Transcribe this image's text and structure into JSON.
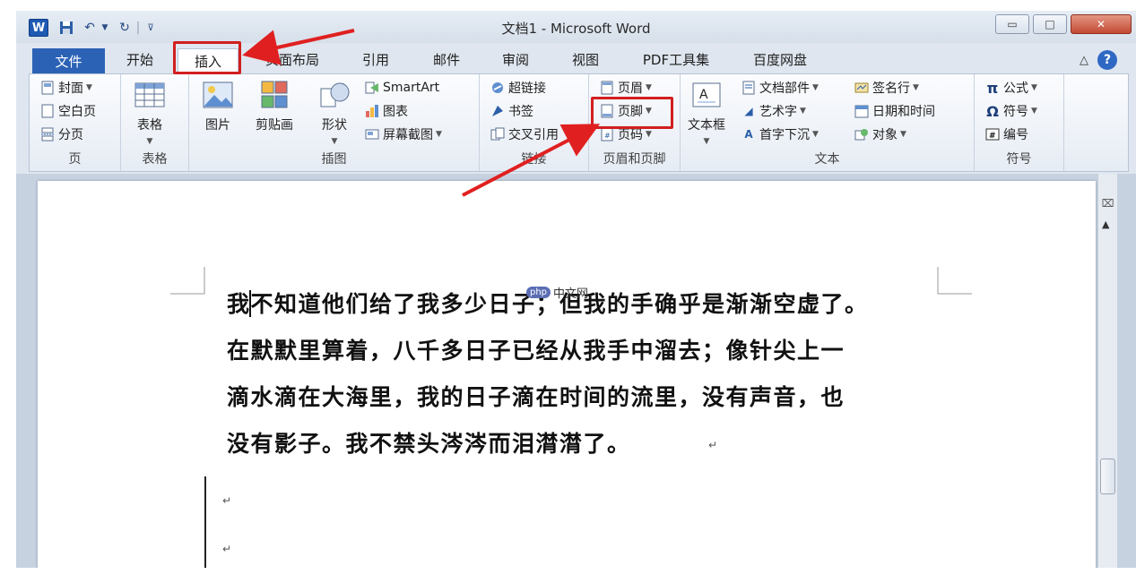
{
  "window": {
    "title": "文档1 - Microsoft Word",
    "logo": "W",
    "controls": {
      "minimize": "▭",
      "maximize": "□",
      "close": "✕"
    }
  },
  "tabs": [
    {
      "label": "文件"
    },
    {
      "label": "开始"
    },
    {
      "label": "插入"
    },
    {
      "label": "页面布局"
    },
    {
      "label": "引用"
    },
    {
      "label": "邮件"
    },
    {
      "label": "审阅"
    },
    {
      "label": "视图"
    },
    {
      "label": "PDF工具集"
    },
    {
      "label": "百度网盘"
    }
  ],
  "ribbon": {
    "pages": {
      "label": "页",
      "items": [
        "封面",
        "空白页",
        "分页"
      ]
    },
    "tables": {
      "label": "表格",
      "button": "表格"
    },
    "illustrations": {
      "label": "插图",
      "picture": "图片",
      "clipart": "剪贴画",
      "shapes": "形状",
      "smartart": "SmartArt",
      "chart": "图表",
      "screenshot": "屏幕截图"
    },
    "links": {
      "label": "链接",
      "items": [
        "超链接",
        "书签",
        "交叉引用"
      ]
    },
    "header_footer": {
      "label": "页眉和页脚",
      "items": [
        "页眉",
        "页脚",
        "页码"
      ]
    },
    "text": {
      "label": "文本",
      "textbox": "文本框",
      "items": [
        "文档部件",
        "艺术字",
        "首字下沉",
        "签名行",
        "日期和时间",
        "对象"
      ]
    },
    "symbols": {
      "label": "符号",
      "items": [
        "公式",
        "符号",
        "编号"
      ]
    }
  },
  "document": {
    "lines": [
      "我不知道他们给了我多少日子；但我的手确乎是渐渐空虚了。",
      "在默默里算着，八千多日子已经从我手中溜去；像针尖上一",
      "滴水滴在大海里，我的日子滴在时间的流里，没有声音，也",
      "没有影子。我不禁头涔涔而泪潸潸了。"
    ],
    "para_mark": "↵"
  },
  "watermark": {
    "logo": "php",
    "text": "中文网"
  },
  "colors": {
    "file_tab": "#2b62b5",
    "highlight": "#d21f1f",
    "arrow": "#e02020"
  }
}
